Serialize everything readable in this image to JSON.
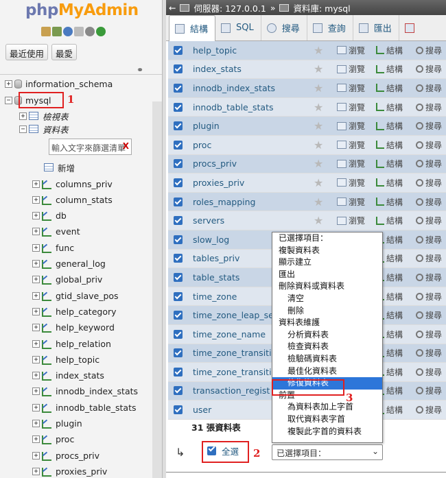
{
  "logo": {
    "php": "php",
    "myadmin": "MyAdmin"
  },
  "sidebar": {
    "recent_button": "最近使用",
    "favorites_button": "最愛",
    "databases": [
      "information_schema",
      "mysql"
    ],
    "views_label": "檢視表",
    "tables_label": "資料表",
    "filter_placeholder": "輸入文字來篩選清單",
    "new_label": "新增",
    "tables": [
      "columns_priv",
      "column_stats",
      "db",
      "event",
      "func",
      "general_log",
      "global_priv",
      "gtid_slave_pos",
      "help_category",
      "help_keyword",
      "help_relation",
      "help_topic",
      "index_stats",
      "innodb_index_stats",
      "innodb_table_stats",
      "plugin",
      "proc",
      "procs_priv",
      "proxies_priv"
    ]
  },
  "annotations": {
    "label1": "1",
    "label2": "2",
    "label3": "3"
  },
  "breadcrumb": {
    "server": "伺服器: 127.0.0.1",
    "sep": "»",
    "database": "資料庫: mysql"
  },
  "tabs": [
    "結構",
    "SQL",
    "搜尋",
    "查詢",
    "匯出"
  ],
  "actions": {
    "browse": "瀏覽",
    "structure": "結構",
    "search": "搜尋"
  },
  "tables": [
    "help_topic",
    "index_stats",
    "innodb_index_stats",
    "innodb_table_stats",
    "plugin",
    "proc",
    "procs_priv",
    "proxies_priv",
    "roles_mapping",
    "servers",
    "slow_log",
    "tables_priv",
    "table_stats",
    "time_zone",
    "time_zone_leap_se",
    "time_zone_name",
    "time_zone_transiti",
    "time_zone_transiti",
    "transaction_regist",
    "user"
  ],
  "footer": {
    "count": "31 張資料表",
    "check_all": "全選",
    "select_value": "已選擇項目："
  },
  "dropdown": [
    {
      "label": "已選擇項目：",
      "sub": false,
      "selected": false
    },
    {
      "label": "複製資料表",
      "sub": false,
      "selected": false
    },
    {
      "label": "顯示建立",
      "sub": false,
      "selected": false
    },
    {
      "label": "匯出",
      "sub": false,
      "selected": false
    },
    {
      "label": "刪除資料或資料表",
      "sub": false,
      "selected": false
    },
    {
      "label": "清空",
      "sub": true,
      "selected": false
    },
    {
      "label": "刪除",
      "sub": true,
      "selected": false
    },
    {
      "label": "資料表維護",
      "sub": false,
      "selected": false
    },
    {
      "label": "分析資料表",
      "sub": true,
      "selected": false
    },
    {
      "label": "檢查資料表",
      "sub": true,
      "selected": false
    },
    {
      "label": "檢驗碼資料表",
      "sub": true,
      "selected": false
    },
    {
      "label": "最佳化資料表",
      "sub": true,
      "selected": false
    },
    {
      "label": "修復資料表",
      "sub": true,
      "selected": true
    },
    {
      "label": "前置",
      "sub": false,
      "selected": false
    },
    {
      "label": "為資料表加上字首",
      "sub": true,
      "selected": false
    },
    {
      "label": "取代資料表字首",
      "sub": true,
      "selected": false
    },
    {
      "label": "複製此字首的資料表",
      "sub": true,
      "selected": false
    }
  ]
}
